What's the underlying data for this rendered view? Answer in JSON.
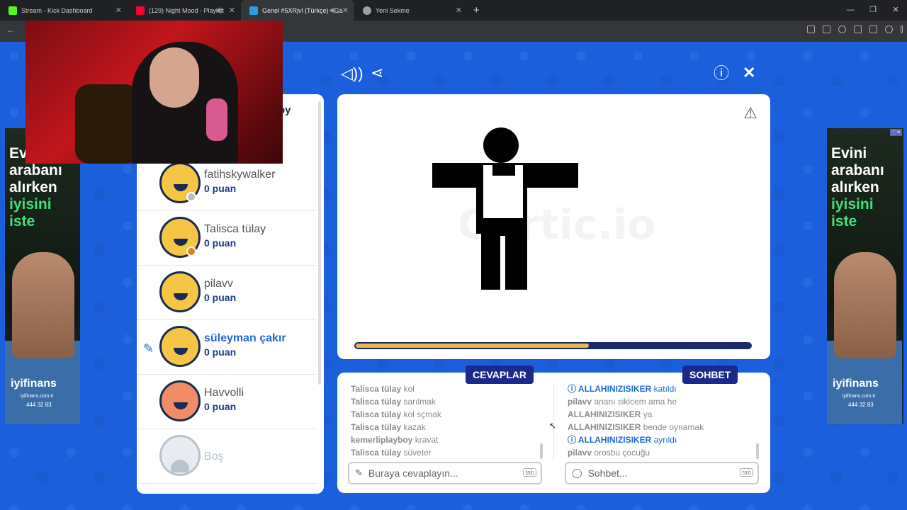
{
  "browser": {
    "tabs": [
      {
        "title": "Stream - Kick Dashboard",
        "color": "#53fc18"
      },
      {
        "title": "(129) Night Mood - Playlist",
        "color": "#ff0033"
      },
      {
        "title": "Genel #5XRjvl (Türkçe) - Ga",
        "color": "#2d9cdb"
      },
      {
        "title": "Yeni Sekme",
        "color": "#9aa0a6"
      }
    ]
  },
  "ads": {
    "headline_1": "Evini",
    "headline_2": "arabanı",
    "headline_3": "alırken",
    "headline_4": "iyisini",
    "headline_5": "iste",
    "brand": "iyifinans",
    "web": "iyifinans.com.tr",
    "phone": "444 32 83"
  },
  "players": {
    "partial_name": "oy",
    "list": [
      {
        "name": "fatihskywalker",
        "score": "0 puan",
        "dot": "#bdbdbd"
      },
      {
        "name": "Talisca tülay",
        "score": "0 puan",
        "dot": "#e08020"
      },
      {
        "name": "pilavv",
        "score": "0 puan"
      },
      {
        "name": "süleyman çakır",
        "score": "0 puan"
      },
      {
        "name": "Havvolli",
        "score": "0 puan"
      }
    ],
    "empty_slot": "Boş"
  },
  "drawing": {
    "watermark": "Gartic.io",
    "progress": 0.59
  },
  "answers": {
    "tab_label": "CEVAPLAR",
    "messages": [
      {
        "user": "Talisca tülay",
        "text": "kol"
      },
      {
        "user": "Talisca tülay",
        "text": "sarılmak"
      },
      {
        "user": "Talisca tülay",
        "text": "kol sçmak"
      },
      {
        "user": "Talisca tülay",
        "text": "kazak"
      },
      {
        "user": "kemerliplayboy",
        "text": "kravat"
      },
      {
        "user": "Talisca tülay",
        "text": "süveter"
      }
    ],
    "placeholder": "Buraya cevaplayın...",
    "tab_key": "tab"
  },
  "chat": {
    "tab_label": "SOHBET",
    "messages": [
      {
        "user": "ALLAHINIZISIKER",
        "text": "katıldı",
        "system": true
      },
      {
        "user": "pilavv",
        "text": "ananı sikicem ama he"
      },
      {
        "user": "ALLAHINIZISIKER",
        "text": "ya"
      },
      {
        "user": "ALLAHINIZISIKER",
        "text": "bende oynamak"
      },
      {
        "user": "ALLAHINIZISIKER",
        "text": "ayrıldı",
        "system": true
      },
      {
        "user": "pilavv",
        "text": "orosbu çocuğu"
      }
    ],
    "placeholder": "Sohbet...",
    "tab_key": "tab"
  }
}
